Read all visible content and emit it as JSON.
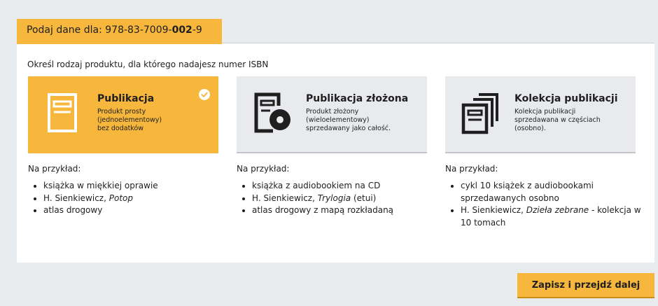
{
  "header": {
    "prefix": "Podaj dane dla: ",
    "isbn_start": "978-83-7009-",
    "isbn_bold": "002",
    "isbn_end": "-9"
  },
  "instruction": "Określ rodzaj produktu, dla którego nadajesz numer ISBN",
  "cards": [
    {
      "title": "Publikacja",
      "desc_lines": [
        "Produkt prosty",
        "(jednoelementowy)",
        "bez dodatków"
      ],
      "icon": "single-document-icon",
      "selected": true
    },
    {
      "title": "Publikacja złożona",
      "desc_lines": [
        "Produkt złożony",
        "(wieloelementowy)",
        "sprzedawany jako całość."
      ],
      "icon": "document-with-disc-icon",
      "selected": false
    },
    {
      "title": "Kolekcja publikacji",
      "desc_lines": [
        "Kolekcja publikacji",
        "sprzedawana w częściach",
        "(osobno)."
      ],
      "icon": "stacked-documents-icon",
      "selected": false
    }
  ],
  "examples": [
    {
      "label": "Na przykład:",
      "items": [
        {
          "text": "książka w miękkiej oprawie",
          "italic": "",
          "suffix": ""
        },
        {
          "text": "H. Sienkiewicz, ",
          "italic": "Potop",
          "suffix": ""
        },
        {
          "text": "atlas drogowy",
          "italic": "",
          "suffix": ""
        }
      ]
    },
    {
      "label": "Na przykład:",
      "items": [
        {
          "text": "książka z audiobookiem na CD",
          "italic": "",
          "suffix": ""
        },
        {
          "text": "H. Sienkiewicz, ",
          "italic": "Trylogia",
          "suffix": " (etui)"
        },
        {
          "text": "atlas drogowy z mapą rozkładaną",
          "italic": "",
          "suffix": ""
        }
      ]
    },
    {
      "label": "Na przykład:",
      "items": [
        {
          "text": "cykl 10 książek z audiobookami sprzedawanych osobno",
          "italic": "",
          "suffix": ""
        },
        {
          "text": "H. Sienkiewicz, ",
          "italic": "Dzieła zebrane",
          "suffix": " - kolekcja w 10 tomach"
        }
      ]
    }
  ],
  "next_button_label": "Zapisz i przejdź dalej",
  "colors": {
    "accent": "#f6b73c",
    "card_bg": "#e8eaed",
    "page_bg": "#e9ecef",
    "text": "#1f1f1f"
  }
}
